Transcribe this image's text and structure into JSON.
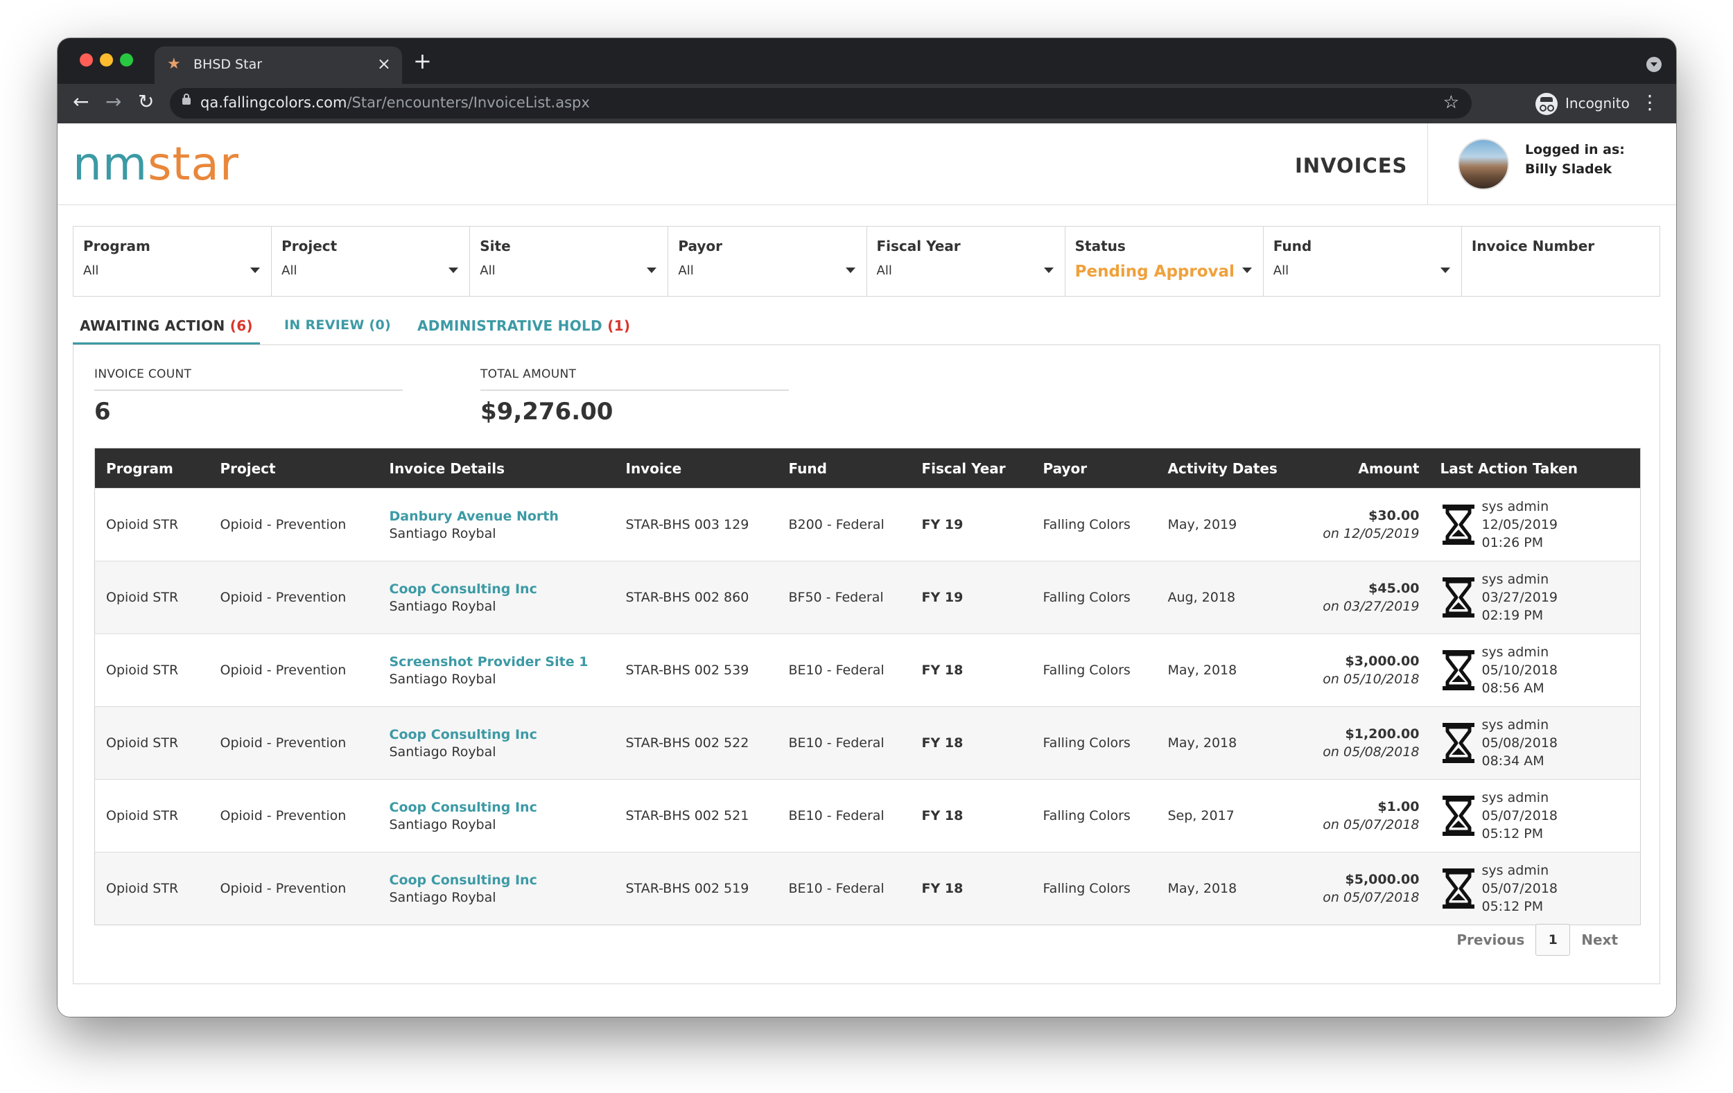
{
  "browser": {
    "tab_title": "BHSD Star",
    "new_tab_icon": "+",
    "close_icon": "×",
    "url_host": "qa.fallingcolors.com",
    "url_path": "/Star/encounters/InvoiceList.aspx",
    "incognito_label": "Incognito",
    "favicon": "★",
    "bookmark_star": "☆",
    "menu": "⋮",
    "back": "←",
    "forward": "→",
    "reload": "↻"
  },
  "header": {
    "logo_nm": "nm",
    "logo_star": "star",
    "page_title": "INVOICES",
    "login_label": "Logged in as:",
    "login_name": "Billy Sladek"
  },
  "filters": [
    {
      "label": "Program",
      "value": "All"
    },
    {
      "label": "Project",
      "value": "All"
    },
    {
      "label": "Site",
      "value": "All"
    },
    {
      "label": "Payor",
      "value": "All"
    },
    {
      "label": "Fiscal Year",
      "value": "All"
    },
    {
      "label": "Status",
      "value": "Pending Approval"
    },
    {
      "label": "Fund",
      "value": "All"
    },
    {
      "label": "Invoice Number",
      "value": ""
    }
  ],
  "tabs": {
    "awaiting": {
      "label": "AWAITING ACTION",
      "count": "(6)"
    },
    "review": {
      "label": "IN REVIEW (0)"
    },
    "hold": {
      "label": "ADMINISTRATIVE HOLD",
      "count": "(1)"
    }
  },
  "stats": {
    "count_label": "INVOICE COUNT",
    "count_value": "6",
    "total_label": "TOTAL AMOUNT",
    "total_value": "$9,276.00"
  },
  "table": {
    "columns": [
      "Program",
      "Project",
      "Invoice Details",
      "Invoice",
      "Fund",
      "Fiscal Year",
      "Payor",
      "Activity Dates",
      "Amount",
      "Last Action Taken"
    ],
    "rows": [
      {
        "program": "Opioid STR",
        "project": "Opioid - Prevention",
        "provider": "Danbury Avenue North",
        "contact": "Santiago Roybal",
        "invoice": "STAR-BHS 003 129",
        "fund": "B200 - Federal",
        "fy": "FY 19",
        "payor": "Falling Colors",
        "dates": "May, 2019",
        "amount": "$30.00",
        "amount_date": "on 12/05/2019",
        "action_user": "sys admin",
        "action_date": "12/05/2019",
        "action_time": "01:26 PM"
      },
      {
        "program": "Opioid STR",
        "project": "Opioid - Prevention",
        "provider": "Coop Consulting Inc",
        "contact": "Santiago Roybal",
        "invoice": "STAR-BHS 002 860",
        "fund": "BF50 - Federal",
        "fy": "FY 19",
        "payor": "Falling Colors",
        "dates": "Aug, 2018",
        "amount": "$45.00",
        "amount_date": "on 03/27/2019",
        "action_user": "sys admin",
        "action_date": "03/27/2019",
        "action_time": "02:19 PM"
      },
      {
        "program": "Opioid STR",
        "project": "Opioid - Prevention",
        "provider": "Screenshot Provider Site 1",
        "contact": "Santiago Roybal",
        "invoice": "STAR-BHS 002 539",
        "fund": "BE10 - Federal",
        "fy": "FY 18",
        "payor": "Falling Colors",
        "dates": "May, 2018",
        "amount": "$3,000.00",
        "amount_date": "on 05/10/2018",
        "action_user": "sys admin",
        "action_date": "05/10/2018",
        "action_time": "08:56 AM"
      },
      {
        "program": "Opioid STR",
        "project": "Opioid - Prevention",
        "provider": "Coop Consulting Inc",
        "contact": "Santiago Roybal",
        "invoice": "STAR-BHS 002 522",
        "fund": "BE10 - Federal",
        "fy": "FY 18",
        "payor": "Falling Colors",
        "dates": "May, 2018",
        "amount": "$1,200.00",
        "amount_date": "on 05/08/2018",
        "action_user": "sys admin",
        "action_date": "05/08/2018",
        "action_time": "08:34 AM"
      },
      {
        "program": "Opioid STR",
        "project": "Opioid - Prevention",
        "provider": "Coop Consulting Inc",
        "contact": "Santiago Roybal",
        "invoice": "STAR-BHS 002 521",
        "fund": "BE10 - Federal",
        "fy": "FY 18",
        "payor": "Falling Colors",
        "dates": "Sep, 2017",
        "amount": "$1.00",
        "amount_date": "on 05/07/2018",
        "action_user": "sys admin",
        "action_date": "05/07/2018",
        "action_time": "05:12 PM"
      },
      {
        "program": "Opioid STR",
        "project": "Opioid - Prevention",
        "provider": "Coop Consulting Inc",
        "contact": "Santiago Roybal",
        "invoice": "STAR-BHS 002 519",
        "fund": "BE10 - Federal",
        "fy": "FY 18",
        "payor": "Falling Colors",
        "dates": "May, 2018",
        "amount": "$5,000.00",
        "amount_date": "on 05/07/2018",
        "action_user": "sys admin",
        "action_date": "05/07/2018",
        "action_time": "05:12 PM"
      }
    ]
  },
  "pager": {
    "previous": "Previous",
    "page": "1",
    "next": "Next"
  },
  "colors": {
    "teal": "#3c9aa5",
    "orange": "#e9873b",
    "status_orange": "#f0a13c",
    "count_red": "#d9352c",
    "fy_green": "#2e7d1e",
    "header_dark": "#2f2f2f"
  }
}
